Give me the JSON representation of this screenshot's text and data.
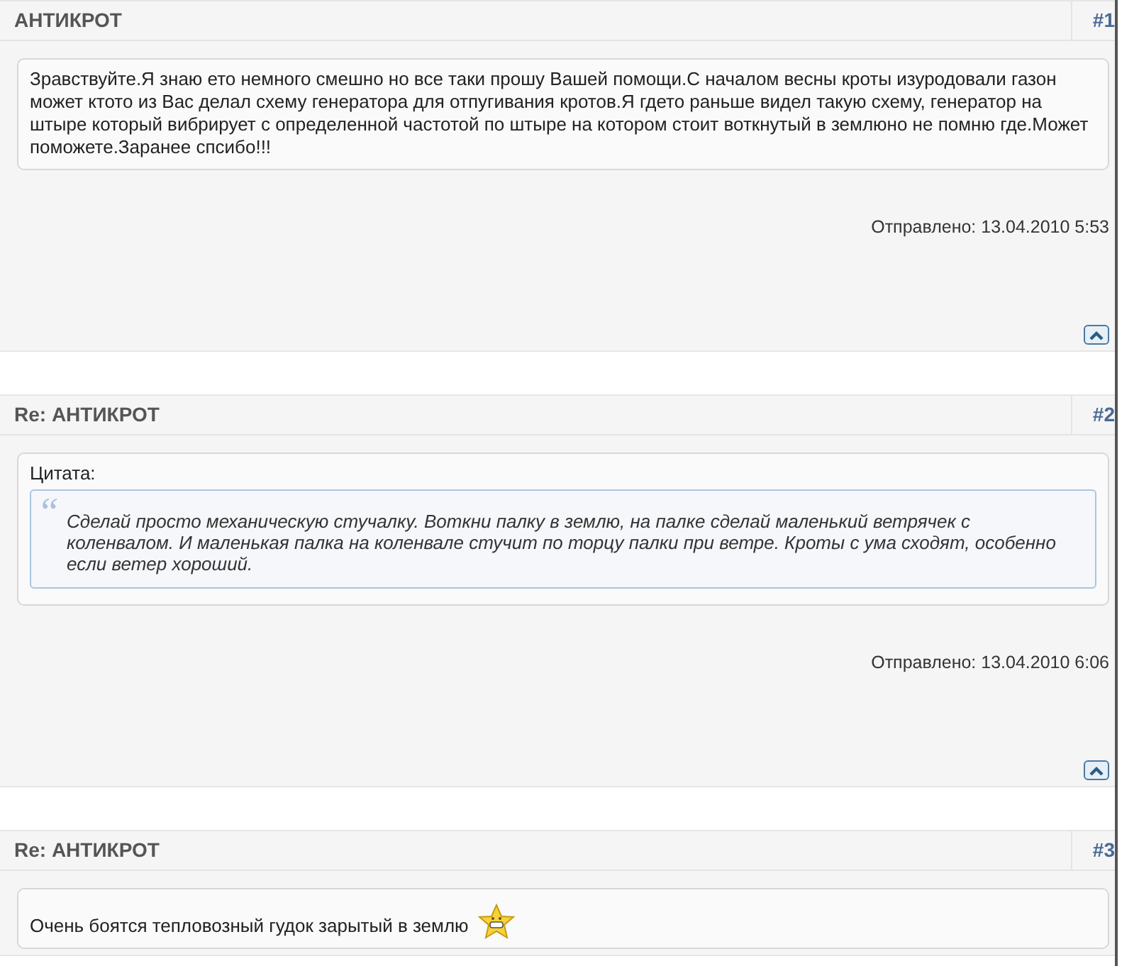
{
  "posts": [
    {
      "title": "АНТИКРОТ",
      "number": "#1",
      "content": {
        "kind": "text",
        "text": "Зравствуйте.Я знаю ето немного смешно но все таки прошу Вашей помощи.С началом весны кроты изуродовали газон может ктото из Вас делал схему генератора для отпугивания кротов.Я гдето раньше видел такую схему, генератор на штыре который вибрирует с определенной частотой по штыре на котором стоит воткнутый в землюно не помню где.Может поможете.Заранее спсибо!!!"
      },
      "posted": "Отправлено: 13.04.2010 5:53"
    },
    {
      "title": "Re: АНТИКРОТ",
      "number": "#2",
      "content": {
        "kind": "quote",
        "label": "Цитата:",
        "quote_mark": "“",
        "text": "Сделай просто механическую стучалку. Воткни палку в землю, на палке сделай маленький ветрячек с коленвалом. И маленькая палка на коленвале стучит по торцу палки при ветре. Кроты с ума сходят, особенно если ветер хороший."
      },
      "posted": "Отправлено: 13.04.2010 6:06"
    },
    {
      "title": "Re: АНТИКРОТ",
      "number": "#3",
      "content": {
        "kind": "smiley",
        "text": "Очень боятся тепловозный гудок зарытый в землю"
      }
    }
  ]
}
